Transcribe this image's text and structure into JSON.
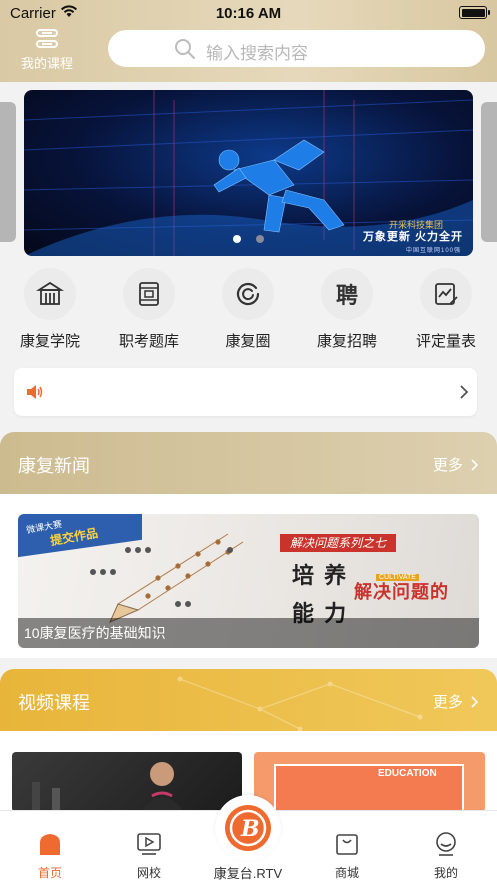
{
  "status_bar": {
    "carrier": "Carrier",
    "time": "10:16 AM"
  },
  "header": {
    "my_course_label": "我的课程",
    "search_placeholder": "输入搜索内容"
  },
  "banner": {
    "caption_top": "开采科技集团",
    "caption_main": "万象更新 火力全开",
    "caption_sub": "中国互联网100强",
    "page_count": 2,
    "active_page": 1
  },
  "quick_nav": [
    {
      "label": "康复学院",
      "icon": "school-building-icon"
    },
    {
      "label": "职考题库",
      "icon": "question-bank-icon"
    },
    {
      "label": "康复圈",
      "icon": "circle-community-icon"
    },
    {
      "label": "康复招聘",
      "icon": "recruit-icon"
    },
    {
      "label": "评定量表",
      "icon": "assessment-chart-icon"
    }
  ],
  "notice": {
    "icon": "speaker-icon",
    "text": ""
  },
  "news_section": {
    "title": "康复新闻",
    "more": "更多",
    "card": {
      "ribbon_line1": "微课大赛",
      "ribbon_line2": "提交作品",
      "tag": "解决问题系列之七",
      "heading_1": "培 养",
      "heading_2": "解决问题的",
      "heading_3": "能 力",
      "badge": "CULTIVATE",
      "caption": "10康复医疗的基础知识"
    }
  },
  "video_section": {
    "title": "视频课程",
    "more": "更多",
    "thumb2_text": "EDUCATION"
  },
  "tabbar": {
    "tabs": [
      {
        "label": "首页",
        "icon": "home-icon",
        "active": true
      },
      {
        "label": "网校",
        "icon": "video-play-icon",
        "active": false
      },
      {
        "label": "康复台.RTV",
        "icon": "brand-logo-icon",
        "active": false
      },
      {
        "label": "商城",
        "icon": "shop-icon",
        "active": false
      },
      {
        "label": "我的",
        "icon": "profile-icon",
        "active": false
      }
    ]
  },
  "colors": {
    "header_gold": "#d9c9a4",
    "news_head": "#cdbb90",
    "video_head": "#e8b53a",
    "accent_orange": "#ee6a2f"
  }
}
